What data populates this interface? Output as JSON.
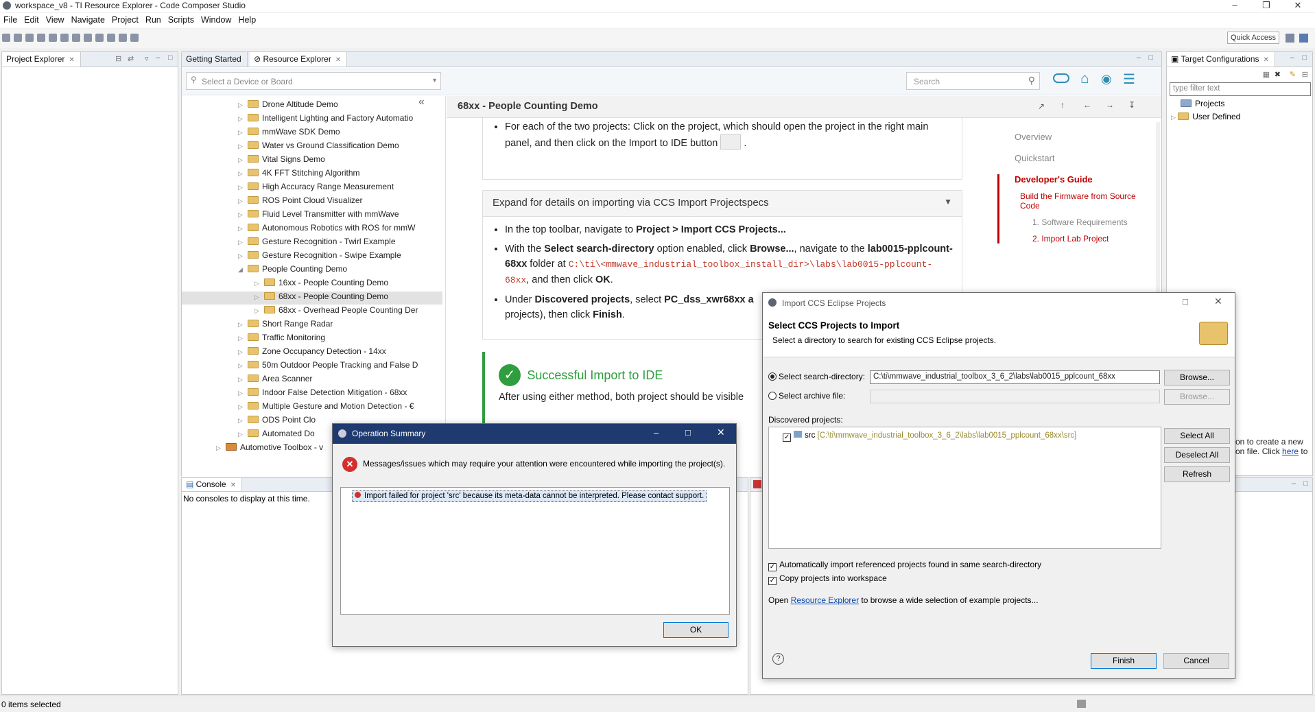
{
  "window": {
    "title": "workspace_v8 - TI Resource Explorer - Code Composer Studio"
  },
  "menu": [
    "File",
    "Edit",
    "View",
    "Navigate",
    "Project",
    "Run",
    "Scripts",
    "Window",
    "Help"
  ],
  "toolbar": {
    "quick_access": "Quick Access"
  },
  "project_explorer": {
    "tab": "Project Explorer"
  },
  "editor_tabs": {
    "getting_started": "Getting Started",
    "resource_explorer": "Resource Explorer"
  },
  "rex": {
    "device_placeholder": "Select a Device or Board",
    "search_placeholder": "Search",
    "tree": [
      {
        "label": "Drone Altitude Demo",
        "level": 1,
        "expand": "collapsed"
      },
      {
        "label": "Intelligent Lighting and Factory Automatio",
        "level": 1,
        "expand": "collapsed"
      },
      {
        "label": "mmWave SDK Demo",
        "level": 1,
        "expand": "collapsed"
      },
      {
        "label": "Water vs Ground Classification Demo",
        "level": 1,
        "expand": "collapsed"
      },
      {
        "label": "Vital Signs Demo",
        "level": 1,
        "expand": "collapsed"
      },
      {
        "label": "4K FFT Stitching Algorithm",
        "level": 1,
        "expand": "collapsed"
      },
      {
        "label": "High Accuracy Range Measurement",
        "level": 1,
        "expand": "collapsed"
      },
      {
        "label": "ROS Point Cloud Visualizer",
        "level": 1,
        "expand": "collapsed"
      },
      {
        "label": "Fluid Level Transmitter with mmWave",
        "level": 1,
        "expand": "collapsed"
      },
      {
        "label": "Autonomous Robotics with ROS for mmW",
        "level": 1,
        "expand": "collapsed"
      },
      {
        "label": "Gesture Recognition - Twirl Example",
        "level": 1,
        "expand": "collapsed"
      },
      {
        "label": "Gesture Recognition - Swipe Example",
        "level": 1,
        "expand": "collapsed"
      },
      {
        "label": "People Counting Demo",
        "level": 1,
        "expand": "expanded"
      },
      {
        "label": "16xx - People Counting Demo",
        "level": 2,
        "expand": "collapsed"
      },
      {
        "label": "68xx - People Counting Demo",
        "level": 2,
        "expand": "collapsed",
        "selected": true
      },
      {
        "label": "68xx - Overhead People Counting Der",
        "level": 2,
        "expand": "collapsed"
      },
      {
        "label": "Short Range Radar",
        "level": 1,
        "expand": "collapsed"
      },
      {
        "label": "Traffic Monitoring",
        "level": 1,
        "expand": "collapsed"
      },
      {
        "label": "Zone Occupancy Detection - 14xx",
        "level": 1,
        "expand": "collapsed"
      },
      {
        "label": "50m Outdoor People Tracking and False D",
        "level": 1,
        "expand": "collapsed"
      },
      {
        "label": "Area Scanner",
        "level": 1,
        "expand": "collapsed"
      },
      {
        "label": "Indoor False Detection Mitigation - 68xx",
        "level": 1,
        "expand": "collapsed"
      },
      {
        "label": "Multiple Gesture and Motion Detection - €",
        "level": 1,
        "expand": "collapsed"
      },
      {
        "label": "ODS Point Clo",
        "level": 1,
        "expand": "collapsed"
      },
      {
        "label": "Automated Do",
        "level": 1,
        "expand": "collapsed"
      },
      {
        "label": "Automotive Toolbox - v",
        "level": 0,
        "expand": "collapsed"
      }
    ],
    "doc_title": "68xx - People Counting Demo",
    "bullet0_a": "For each of the two projects: Click on the project, which should open the project in the right main panel, and then click on the Import to IDE button",
    "expand_title": "Expand for details on importing via CCS Import Projectspecs",
    "b1_pre": "In the top toolbar, navigate to ",
    "b1_bold": "Project > Import CCS Projects...",
    "b2_pre": "With the ",
    "b2_b1": "Select search-directory",
    "b2_mid": " option enabled, click ",
    "b2_b2": "Browse...",
    "b2_mid2": ", navigate to the ",
    "b2_b3": "lab0015-pplcount-68xx",
    "b2_mid3": " folder at ",
    "b2_code": "C:\\ti\\<mmwave_industrial_toolbox_install_dir>\\labs\\lab0015-pplcount-68xx",
    "b2_end": ", and then click ",
    "b2_ok": "OK",
    "b2_dot": ".",
    "b3_pre": "Under ",
    "b3_b1": "Discovered projects",
    "b3_mid": ", select ",
    "b3_b2": "PC_dss_xwr68xx a",
    "b3_end": "projects), then click ",
    "b3_fin": "Finish",
    "b3_dot": ".",
    "success": "Successful Import to IDE",
    "after": "After using either method, both project should be visible",
    "nav": {
      "overview": "Overview",
      "quickstart": "Quickstart",
      "dev_guide": "Developer's Guide",
      "build": "Build the Firmware from Source Code",
      "req": "1. Software Requirements",
      "import": "2. Import Lab Project"
    }
  },
  "target_config": {
    "tab": "Target Configurations",
    "filter_placeholder": "type filter text",
    "items": [
      "Projects",
      "User Defined"
    ],
    "hint1": "on to create a new",
    "hint2": "on file. Click ",
    "hint_link": "here",
    "hint3": " to"
  },
  "console": {
    "tab": "Console",
    "text": "No consoles to display at this time."
  },
  "status": {
    "text": "0 items selected"
  },
  "op_summary": {
    "title": "Operation Summary",
    "message": "Messages/issues which may require your attention were encountered while importing the project(s).",
    "issue": "Import failed for project 'src' because its meta-data cannot be interpreted. Please contact support.",
    "ok": "OK"
  },
  "import_dlg": {
    "title": "Import CCS Eclipse Projects",
    "heading": "Select CCS Projects to Import",
    "sub": "Select a directory to search for existing CCS Eclipse projects.",
    "search_dir_label": "Select search-directory:",
    "search_dir_value": "C:\\ti\\mmwave_industrial_toolbox_3_6_2\\labs\\lab0015_pplcount_68xx",
    "archive_label": "Select archive file:",
    "browse": "Browse...",
    "discovered": "Discovered projects:",
    "project_name": "src",
    "project_path": "[C:\\ti\\mmwave_industrial_toolbox_3_6_2\\labs\\lab0015_pplcount_68xx\\src]",
    "select_all": "Select All",
    "deselect_all": "Deselect All",
    "refresh": "Refresh",
    "auto_import": "Automatically import referenced projects found in same search-directory",
    "copy": "Copy projects into workspace",
    "open_pre": "Open ",
    "open_link": "Resource Explorer",
    "open_post": " to browse a wide selection of example projects...",
    "finish": "Finish",
    "cancel": "Cancel"
  },
  "colors": {
    "accent": "#0078d7",
    "ti_red": "#c00000",
    "success_green": "#2e9e3e",
    "code_red": "#c0392b",
    "folder": "#e8c36c"
  }
}
